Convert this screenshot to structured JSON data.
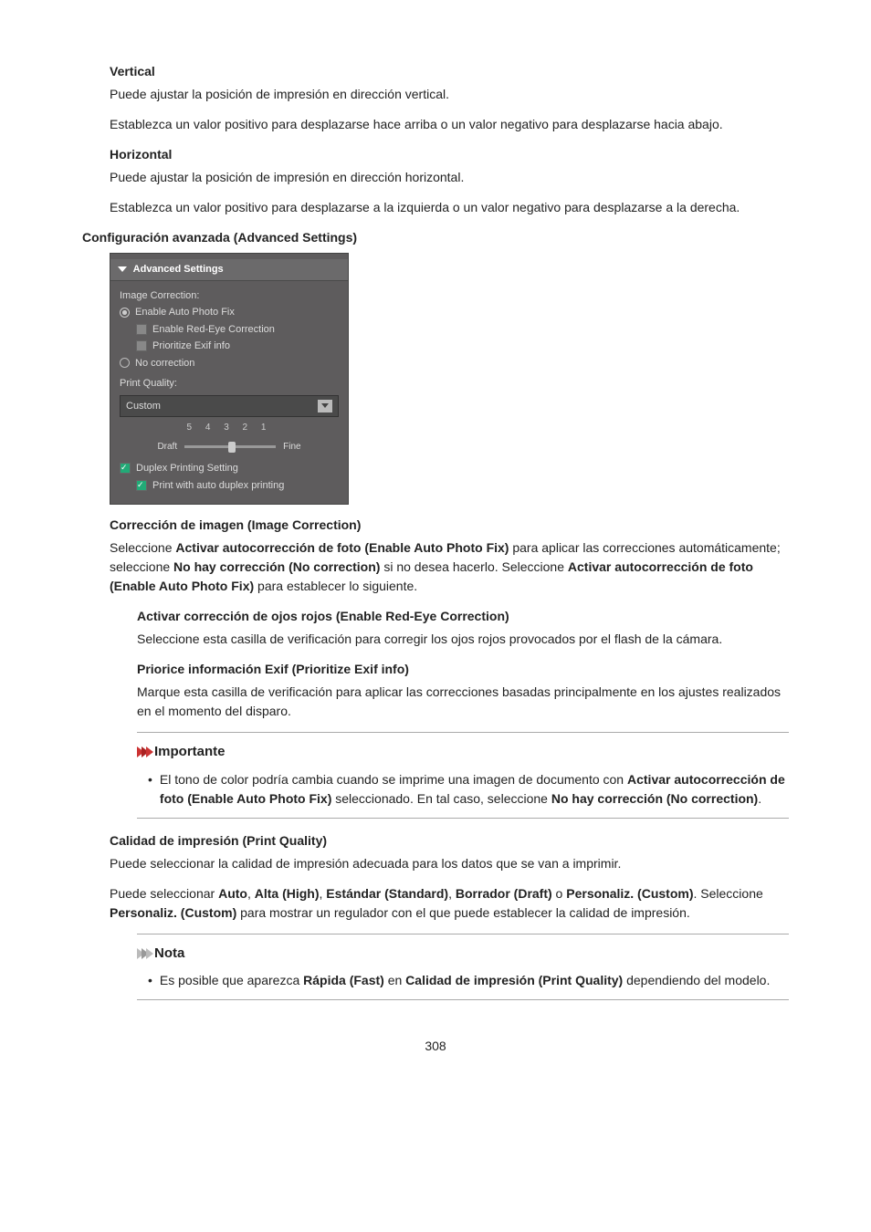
{
  "vertical": {
    "title": "Vertical",
    "p1": "Puede ajustar la posición de impresión en dirección vertical.",
    "p2": "Establezca un valor positivo para desplazarse hace arriba o un valor negativo para desplazarse hacia abajo."
  },
  "horizontal": {
    "title": "Horizontal",
    "p1": "Puede ajustar la posición de impresión en dirección horizontal.",
    "p2": "Establezca un valor positivo para desplazarse a la izquierda o un valor negativo para desplazarse a la derecha."
  },
  "advanced": {
    "title": "Configuración avanzada (Advanced Settings)"
  },
  "screenshot": {
    "header": "Advanced Settings",
    "image_correction": "Image Correction:",
    "enable_auto": "Enable Auto Photo Fix",
    "enable_red_eye": "Enable Red-Eye Correction",
    "prioritize_exif": "Prioritize Exif info",
    "no_correction": "No correction",
    "print_quality": "Print Quality:",
    "custom": "Custom",
    "ticks": "5  4  3  2  1",
    "draft": "Draft",
    "fine": "Fine",
    "duplex": "Duplex Printing Setting",
    "auto_duplex": "Print with auto duplex printing"
  },
  "image_correction": {
    "title": "Corrección de imagen (Image Correction)",
    "p1a": "Seleccione ",
    "p1b": "Activar autocorrección de foto (Enable Auto Photo Fix)",
    "p1c": " para aplicar las correcciones automáticamente; seleccione ",
    "p1d": "No hay corrección (No correction)",
    "p1e": " si no desea hacerlo. Seleccione ",
    "p1f": "Activar autocorrección de foto (Enable Auto Photo Fix)",
    "p1g": " para establecer lo siguiente."
  },
  "red_eye": {
    "title": "Activar corrección de ojos rojos (Enable Red-Eye Correction)",
    "p1": "Seleccione esta casilla de verificación para corregir los ojos rojos provocados por el flash de la cámara."
  },
  "exif": {
    "title": "Priorice información Exif (Prioritize Exif info)",
    "p1": "Marque esta casilla de verificación para aplicar las correcciones basadas principalmente en los ajustes realizados en el momento del disparo."
  },
  "important": {
    "title": "Importante",
    "t1": "El tono de color podría cambia cuando se imprime una imagen de documento con ",
    "b1": "Activar autocorrección de foto (Enable Auto Photo Fix)",
    "t2": " seleccionado. En tal caso, seleccione ",
    "b2": "No hay corrección (No correction)",
    "t3": "."
  },
  "print_quality": {
    "title": "Calidad de impresión (Print Quality)",
    "p1": "Puede seleccionar la calidad de impresión adecuada para los datos que se van a imprimir.",
    "p2a": "Puede seleccionar ",
    "auto": "Auto",
    "sep": ", ",
    "high": "Alta (High)",
    "std": "Estándar (Standard)",
    "draft": "Borrador (Draft)",
    "or": " o ",
    "custom": "Personaliz. (Custom)",
    "p2b": ". Seleccione ",
    "custom2": "Personaliz. (Custom)",
    "p2c": " para mostrar un regulador con el que puede establecer la calidad de impresión."
  },
  "nota": {
    "title": "Nota",
    "t1": "Es posible que aparezca ",
    "b1": "Rápida (Fast)",
    "t2": " en ",
    "b2": "Calidad de impresión (Print Quality)",
    "t3": " dependiendo del modelo."
  },
  "page": "308"
}
